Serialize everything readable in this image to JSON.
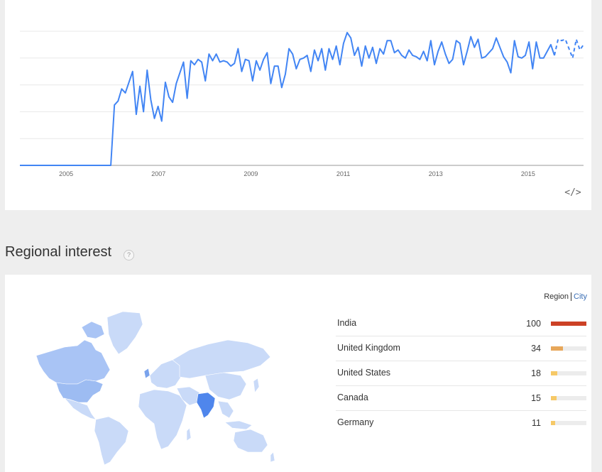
{
  "trend": {
    "x_labels": [
      "2005",
      "2007",
      "2009",
      "2011",
      "2013",
      "2015"
    ],
    "embed_label": "</>",
    "line_color": "#4285f4",
    "chart_data": {
      "type": "line",
      "x_start": 2004.0,
      "x_end": 2016.2,
      "forecast_start": 2015.55,
      "ylim": [
        0,
        100
      ],
      "values": [
        0,
        0,
        0,
        0,
        0,
        0,
        0,
        0,
        0,
        0,
        0,
        0,
        0,
        0,
        0,
        0,
        0,
        0,
        0,
        0,
        0,
        0,
        0,
        0,
        0,
        0,
        45,
        48,
        57,
        54,
        62,
        70,
        38,
        59,
        40,
        71,
        49,
        35,
        44,
        33,
        62,
        51,
        47,
        61,
        69,
        77,
        50,
        78,
        75,
        79,
        77,
        63,
        83,
        78,
        83,
        77,
        78,
        77,
        74,
        76,
        87,
        70,
        79,
        78,
        63,
        78,
        71,
        79,
        84,
        61,
        74,
        74,
        58,
        68,
        87,
        83,
        72,
        79,
        80,
        82,
        70,
        86,
        78,
        87,
        71,
        87,
        79,
        89,
        75,
        91,
        99,
        95,
        82,
        88,
        74,
        89,
        80,
        88,
        76,
        87,
        83,
        93,
        93,
        84,
        86,
        82,
        80,
        86,
        82,
        81,
        79,
        85,
        78,
        93,
        75,
        85,
        92,
        83,
        76,
        79,
        93,
        91,
        75,
        85,
        96,
        88,
        94,
        80,
        81,
        84,
        87,
        95,
        88,
        81,
        77,
        69,
        93,
        81,
        80,
        82,
        92,
        72,
        92,
        80,
        80,
        85,
        90,
        82,
        94,
        93,
        94,
        87,
        80,
        94,
        86,
        90
      ]
    }
  },
  "regional": {
    "title": "Regional interest",
    "help_icon": "?",
    "toggle_region": "Region",
    "toggle_city": "City",
    "items": [
      {
        "name": "India",
        "value": "100",
        "score": 100,
        "color": "#cc4125"
      },
      {
        "name": "United Kingdom",
        "value": "34",
        "score": 34,
        "color": "#e7a75a"
      },
      {
        "name": "United States",
        "value": "18",
        "score": 18,
        "color": "#f6c967"
      },
      {
        "name": "Canada",
        "value": "15",
        "score": 15,
        "color": "#f6c967"
      },
      {
        "name": "Germany",
        "value": "11",
        "score": 11,
        "color": "#f6c967"
      }
    ]
  }
}
